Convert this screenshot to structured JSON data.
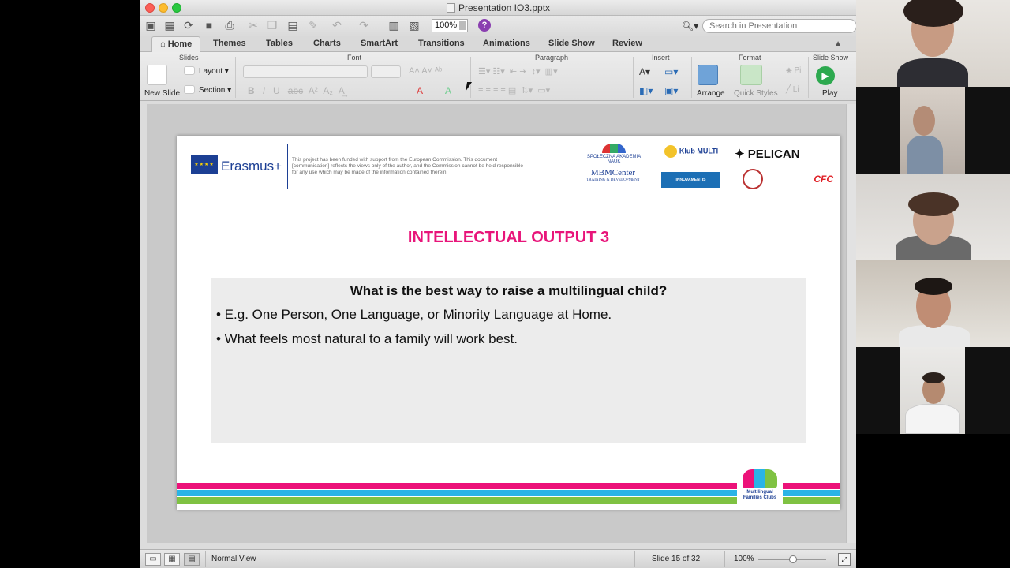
{
  "window": {
    "title": "Presentation IO3.pptx",
    "zoom_value": "100%",
    "search_placeholder": "Search in Presentation"
  },
  "ribbon": {
    "tabs": [
      {
        "label": "Home"
      },
      {
        "label": "Themes"
      },
      {
        "label": "Tables"
      },
      {
        "label": "Charts"
      },
      {
        "label": "SmartArt"
      },
      {
        "label": "Transitions"
      },
      {
        "label": "Animations"
      },
      {
        "label": "Slide Show"
      },
      {
        "label": "Review"
      }
    ],
    "groups": {
      "slides": "Slides",
      "font": "Font",
      "paragraph": "Paragraph",
      "insert": "Insert",
      "format": "Format",
      "slide_show": "Slide Show"
    },
    "buttons": {
      "new_slide": "New Slide",
      "layout": "Layout",
      "section": "Section",
      "arrange": "Arrange",
      "quick_styles": "Quick Styles",
      "play": "Play"
    }
  },
  "slide": {
    "program": "Erasmus+",
    "disclaimer": "This project has been funded with support from the European Commission. This document [communication] reflects the views only of the author, and the Commission cannot be held responsible for any use which may be made of the information contained therein.",
    "partners": {
      "academy": "SPOŁECZNA AKADEMIA NAUK",
      "klub_multi": "Klub MULTI",
      "pelican": "PELICAN",
      "mbm_center": "MBMCenter",
      "mbm_tagline": "TRAINING & DEVELOPMENT",
      "innovamentis": "INNOVAMENTIS",
      "cfc": "CFC"
    },
    "title": "INTELLECTUAL OUTPUT 3",
    "question": "What is the best way to raise a multilingual child?",
    "bullets": [
      "• E.g. One Person, One Language, or Minority Language at Home.",
      "• What feels most natural to a family will work best."
    ],
    "footer_logo": "Multilingual Families Clubs"
  },
  "status": {
    "view_name": "Normal View",
    "slide_indicator": "Slide 15 of 32",
    "zoom": "100%"
  },
  "colors": {
    "title_pink": "#e8157a",
    "stripe_pink": "#ec1279",
    "stripe_cyan": "#2ab4e6",
    "stripe_green": "#7fc242",
    "eu_blue": "#1c3f94"
  }
}
